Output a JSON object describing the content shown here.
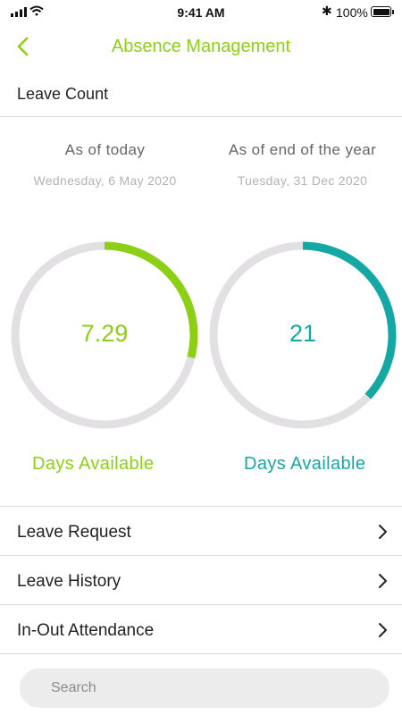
{
  "status_bar": {
    "time": "9:41 AM",
    "battery": "100%",
    "icons": [
      "signal-icon",
      "wifi-icon",
      "bluetooth-icon",
      "battery-icon"
    ]
  },
  "nav": {
    "back_icon": "chevron-left-icon",
    "title": "Absence Management"
  },
  "section": {
    "title": "Leave Count"
  },
  "leave_summary": {
    "today": {
      "heading": "As of today",
      "date": "Wednesday, 6 May 2020",
      "value": "7.29",
      "progress": 0.29,
      "label": "Days Available",
      "color": "#8ccf14"
    },
    "year_end": {
      "heading": "As of end of the year",
      "date": "Tuesday, 31 Dec 2020",
      "value": "21",
      "progress": 0.37,
      "label": "Days Available",
      "color": "#14a8a5"
    },
    "track_color": "#e3e0e4"
  },
  "menu": {
    "items": [
      {
        "label": "Leave Request",
        "icon": "chevron-right-icon"
      },
      {
        "label": "Leave History",
        "icon": "chevron-right-icon"
      },
      {
        "label": "In-Out Attendance",
        "icon": "chevron-right-icon"
      }
    ]
  },
  "search": {
    "placeholder": "Search"
  }
}
